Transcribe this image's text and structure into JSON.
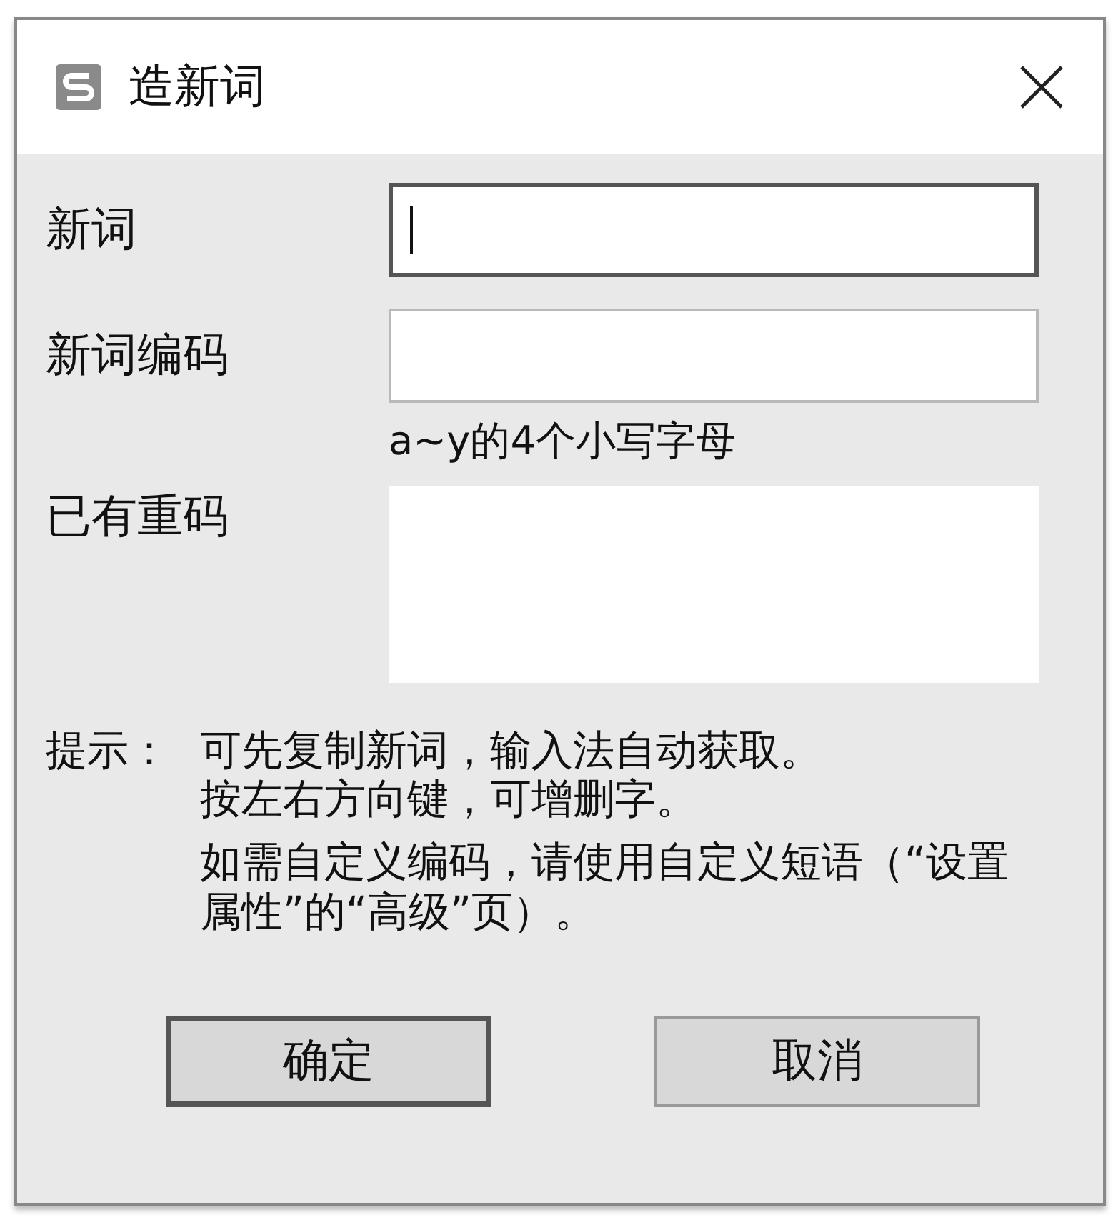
{
  "window": {
    "title": "造新词"
  },
  "fields": [
    {
      "kind": "input",
      "label": "新词",
      "focused": true
    },
    {
      "kind": "input",
      "label": "新词编码",
      "focused": false,
      "note": "a~y的4个小写字母"
    },
    {
      "kind": "textarea",
      "label": "已有重码",
      "focused": false
    }
  ],
  "hint": {
    "label": "提示：",
    "paragraphs": [
      [
        "可先复制新词，输入法自动获取。",
        "按左右方向键，可增删字。"
      ],
      [
        "如需自定义编码，请使用自定义短语（“设置属性”的“高级”页）。"
      ]
    ]
  },
  "buttons": [
    {
      "label": "确定",
      "default": true
    },
    {
      "label": "取消",
      "default": false
    }
  ]
}
